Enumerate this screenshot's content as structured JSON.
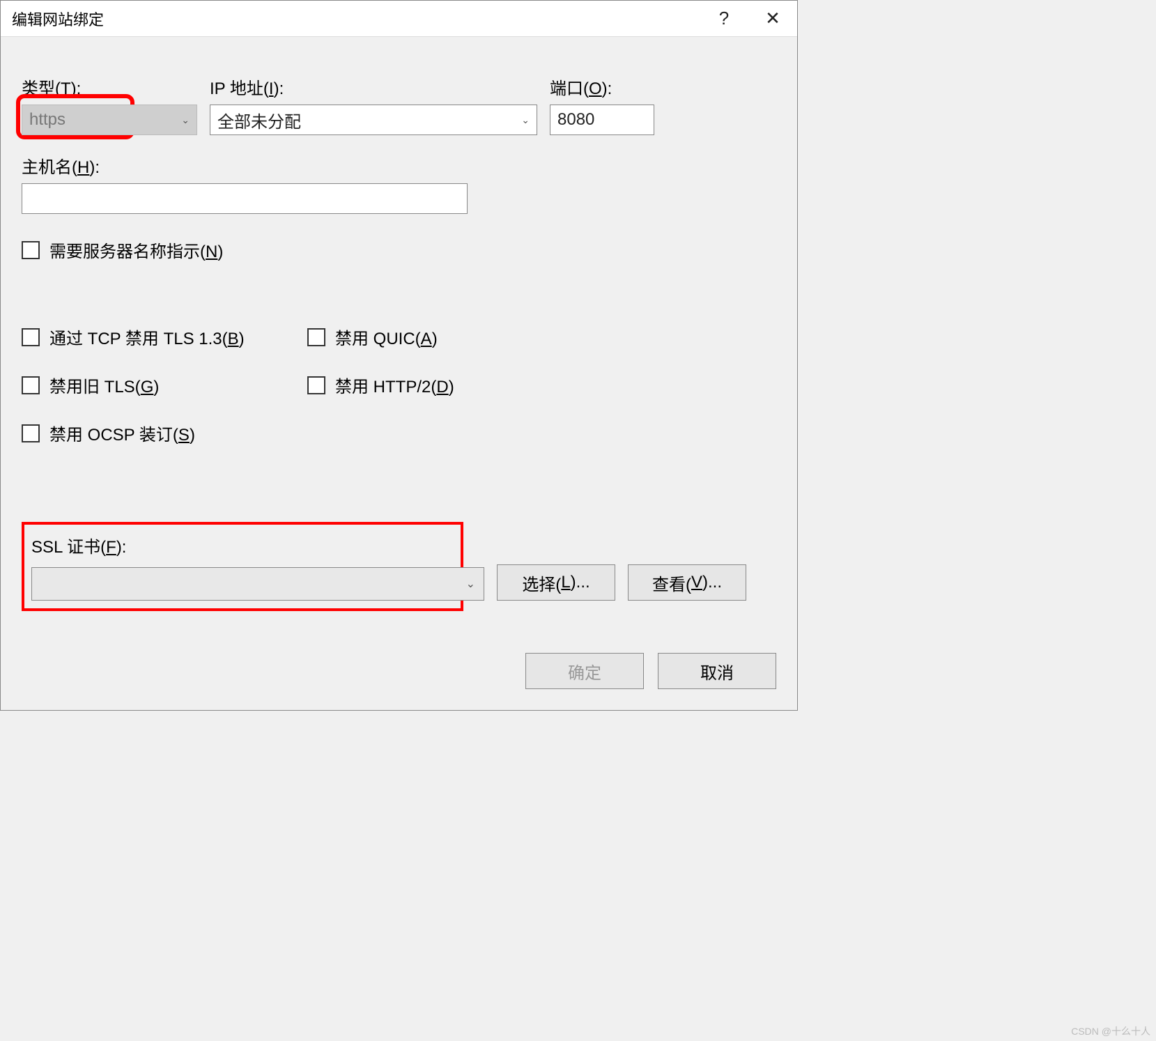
{
  "titlebar": {
    "title": "编辑网站绑定",
    "help_icon": "?",
    "close_icon": "✕"
  },
  "fields": {
    "type": {
      "label_text": "类型(",
      "akey": "T",
      "label_suffix": "):",
      "value": "https"
    },
    "ip": {
      "label_text": "IP 地址(",
      "akey": "I",
      "label_suffix": "):",
      "value": "全部未分配"
    },
    "port": {
      "label_text": "端口(",
      "akey": "O",
      "label_suffix": "):",
      "value": "8080"
    },
    "host": {
      "label_text": "主机名(",
      "akey": "H",
      "label_suffix": "):",
      "value": ""
    }
  },
  "checkboxes": {
    "sni": {
      "text_pre": "需要服务器名称指示(",
      "akey": "N",
      "text_suf": ")"
    },
    "tls13": {
      "text_pre": "通过 TCP 禁用 TLS 1.3(",
      "akey": "B",
      "text_suf": ")"
    },
    "quic": {
      "text_pre": "禁用 QUIC(",
      "akey": "A",
      "text_suf": ")"
    },
    "legacy": {
      "text_pre": "禁用旧 TLS(",
      "akey": "G",
      "text_suf": ")"
    },
    "http2": {
      "text_pre": "禁用 HTTP/2(",
      "akey": "D",
      "text_suf": ")"
    },
    "ocsp": {
      "text_pre": "禁用 OCSP 装订(",
      "akey": "S",
      "text_suf": ")"
    }
  },
  "ssl": {
    "label_text": "SSL 证书(",
    "akey": "F",
    "label_suffix": "):",
    "value": ""
  },
  "buttons": {
    "select": {
      "text": "选择(",
      "akey": "L",
      "suf": ")..."
    },
    "view": {
      "text": "查看(",
      "akey": "V",
      "suf": ")..."
    },
    "ok": "确定",
    "cancel": "取消"
  },
  "watermark": "CSDN @十么十人"
}
